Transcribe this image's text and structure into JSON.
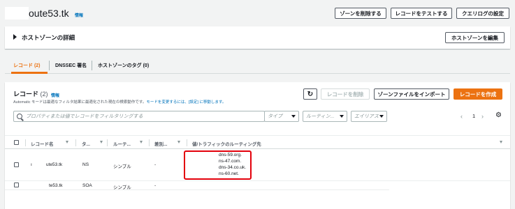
{
  "header": {
    "title": "oute53.tk",
    "info": "情報",
    "buttons": {
      "delete_zone": "ゾーンを削除する",
      "test_record": "レコードをテストする",
      "query_log": "クエリログの設定"
    }
  },
  "details_panel": {
    "title": "ホストゾーンの詳細",
    "edit_button": "ホストゾーンを編集"
  },
  "tabs": [
    {
      "label": "レコード (2)",
      "active": true
    },
    {
      "label": "DNSSEC 署名",
      "active": false
    },
    {
      "label": "ホストゾーンのタグ (0)",
      "active": false
    }
  ],
  "records": {
    "title": "レコード",
    "count": "(2)",
    "info": "情報",
    "desc_prefix": "Automatic モードは最適なフィルタ結果に最適化された現在の検索動作です。",
    "desc_link": "モードを変更するには、[設定] に移動します。",
    "buttons": {
      "refresh": "↻",
      "delete_record": "レコードを削除",
      "import_zone": "ゾーンファイルをインポート",
      "create_record": "レコードを作成"
    },
    "search_placeholder": "プロパティまたは値でレコードをフィルタリングする",
    "filters": {
      "type": "タイプ",
      "routing": "ルーティン...",
      "alias": "エイリアス"
    },
    "pager": {
      "page": "1",
      "prev": "‹",
      "next": "›"
    },
    "settings_icon": "⚙",
    "columns": {
      "name": "レコード名",
      "type": "タ...",
      "routing": "ルーテ...",
      "diff": "差別...",
      "value": "値/トラフィックのルーティング先"
    },
    "rows": [
      {
        "name_prefix": "ı",
        "name": "ute53.tk",
        "type": "NS",
        "routing": "シンプル",
        "diff": "-",
        "values": [
          "dns-59.org.",
          "ns-47.com.",
          "dns-34.co.uk.",
          "ns-60.net."
        ]
      },
      {
        "name": "te53.tk",
        "type": "SOA",
        "routing": "シンプル",
        "diff": "-"
      }
    ]
  },
  "colors": {
    "accent": "#ec7211",
    "link": "#0073bb",
    "highlight": "#e3000b"
  }
}
